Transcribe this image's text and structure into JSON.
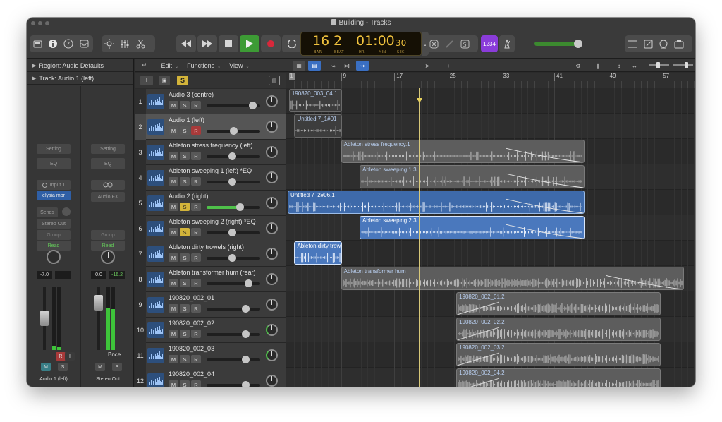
{
  "window": {
    "title": "Building - Tracks"
  },
  "lcd": {
    "bar": "16",
    "beat": "2",
    "time_main": "01:00",
    "time_sec": "30",
    "labels": [
      "BAR",
      "BEAT",
      "HR",
      "MIN",
      "SEC"
    ]
  },
  "tuner_label": "1234",
  "toolbar": {
    "menu_edit": "Edit",
    "menu_functions": "Functions",
    "menu_view": "View"
  },
  "inspector": {
    "region_label": "Region: Audio Defaults",
    "track_label": "Track: Audio 1 (left)",
    "strip_a": {
      "setting": "Setting",
      "eq": "EQ",
      "input": "Input 1",
      "plugin": "elysia mpr",
      "sends": "Sends",
      "output": "Stereo Out",
      "group": "Group",
      "automation": "Read",
      "value1": "-7.0",
      "value2": "",
      "name": "Audio 1 (left)",
      "mute": "M",
      "solo": "S",
      "r": "R",
      "i": "I"
    },
    "strip_b": {
      "setting": "Setting",
      "eq": "EQ",
      "fx": "Audio FX",
      "group": "Group",
      "automation": "Read",
      "value1": "0.0",
      "value2": "-16.2",
      "bounce": "Bnce",
      "name": "Stereo Out",
      "mute": "M",
      "solo": "S"
    }
  },
  "ruler": {
    "marks": [
      "1",
      "9",
      "17",
      "25",
      "33",
      "41",
      "49",
      "57"
    ]
  },
  "tracks": [
    {
      "num": "1",
      "name": "Audio 3 (centre)",
      "solo": false,
      "rec": false,
      "vol": 0.85,
      "selected": false
    },
    {
      "num": "2",
      "name": "Audio 1 (left)",
      "solo": false,
      "rec": true,
      "vol": 0.5,
      "selected": true
    },
    {
      "num": "3",
      "name": "Ableton stress frequency (left)",
      "solo": false,
      "rec": false,
      "vol": 0.48,
      "selected": false
    },
    {
      "num": "4",
      "name": "Ableton sweeping 1 (left) *EQ",
      "solo": false,
      "rec": false,
      "vol": 0.48,
      "selected": false
    },
    {
      "num": "5",
      "name": "Audio 2 (right)",
      "solo": true,
      "rec": false,
      "vol": 0.62,
      "selected": false
    },
    {
      "num": "6",
      "name": "Ableton sweeping 2 (right) *EQ",
      "solo": true,
      "rec": false,
      "vol": 0.48,
      "selected": false
    },
    {
      "num": "7",
      "name": "Ableton dirty trowels (right)",
      "solo": false,
      "rec": false,
      "vol": 0.48,
      "selected": false
    },
    {
      "num": "8",
      "name": "Ableton transformer hum (rear)",
      "solo": false,
      "rec": false,
      "vol": 0.78,
      "selected": false
    },
    {
      "num": "9",
      "name": "190820_002_01",
      "solo": false,
      "rec": false,
      "vol": 0.72,
      "selected": false
    },
    {
      "num": "10",
      "name": "190820_002_02",
      "solo": false,
      "rec": false,
      "vol": 0.72,
      "selected": false
    },
    {
      "num": "11",
      "name": "190820_002_03",
      "solo": false,
      "rec": false,
      "vol": 0.72,
      "selected": false
    },
    {
      "num": "12",
      "name": "190820_002_04",
      "solo": false,
      "rec": false,
      "vol": 0.72,
      "selected": false
    }
  ],
  "regions": [
    {
      "lane": 0,
      "start": 1.2,
      "end": 9.2,
      "name": "190820_003_04.1",
      "style": "dark"
    },
    {
      "lane": 1,
      "start": 2.0,
      "end": 9.2,
      "name": "Untitled 7_1#01",
      "style": "dark"
    },
    {
      "lane": 2,
      "start": 9.0,
      "end": 45.5,
      "name": "Ableton stress frequency.1",
      "style": "grey"
    },
    {
      "lane": 3,
      "start": 11.8,
      "end": 45.5,
      "name": "Ableton sweeping 1.3",
      "style": "grey"
    },
    {
      "lane": 4,
      "start": 1.0,
      "end": 45.5,
      "name": "Untitled 7_2#06.1",
      "style": "blue"
    },
    {
      "lane": 5,
      "start": 11.8,
      "end": 45.5,
      "name": "Ableton sweeping 2.3",
      "style": "bluesel"
    },
    {
      "lane": 6,
      "start": 2.0,
      "end": 9.2,
      "name": "Ableton dirty trowels",
      "style": "bluesel"
    },
    {
      "lane": 7,
      "start": 9.0,
      "end": 60.5,
      "name": "Ableton transformer hum",
      "style": "grey"
    },
    {
      "lane": 8,
      "start": 26.3,
      "end": 57.0,
      "name": "190820_002_01.2",
      "style": "grey"
    },
    {
      "lane": 9,
      "start": 26.3,
      "end": 57.0,
      "name": "190820_002_02.2",
      "style": "grey"
    },
    {
      "lane": 10,
      "start": 26.3,
      "end": 57.0,
      "name": "190820_002_03.2",
      "style": "grey"
    },
    {
      "lane": 11,
      "start": 26.3,
      "end": 57.0,
      "name": "190820_002_04.2",
      "style": "grey"
    }
  ],
  "playhead_bar": 16.9,
  "colors": {
    "play": "#3d9b35",
    "record": "#d8283b",
    "solo": "#d3b43a",
    "region_blue": "#3e6aaa",
    "lcd_text": "#f0c23e",
    "tuner": "#8a3cd9"
  },
  "icons": [
    "library-icon",
    "info-icon",
    "help-icon",
    "inbox-icon",
    "brightness-icon",
    "mixer-icon",
    "scissors-icon",
    "rewind-icon",
    "fast-forward-icon",
    "stop-icon",
    "play-icon",
    "record-icon",
    "cycle-icon",
    "replace-icon",
    "pencil-icon",
    "solo-mode-icon",
    "tuner-icon",
    "metronome-icon",
    "list-icon",
    "notepad-icon",
    "loops-icon",
    "browser-icon"
  ]
}
